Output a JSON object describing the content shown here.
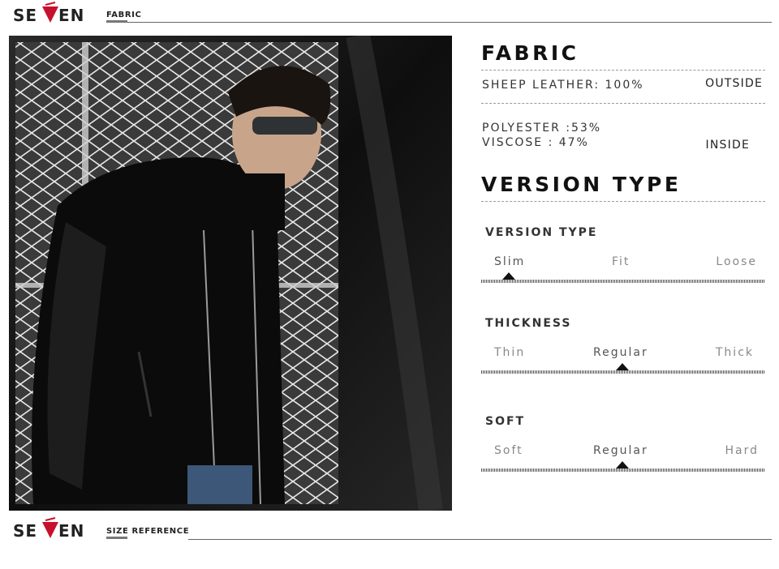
{
  "brand": {
    "name": "SEVEN"
  },
  "header": {
    "section": "FABRIC"
  },
  "footer": {
    "section": "SIZE REFERENCE"
  },
  "fabric": {
    "title": "FABRIC",
    "outside": {
      "line1": "SHEEP LEATHER: 100%",
      "side": "OUTSIDE"
    },
    "inside": {
      "line1": "POLYESTER :53%",
      "line2": "VISCOSE : 47%",
      "side": "INSIDE"
    }
  },
  "version": {
    "title": "VERSION TYPE",
    "scales": [
      {
        "name": "VERSION TYPE",
        "options": [
          "Slim",
          "Fit",
          "Loose"
        ],
        "selected": "Slim"
      },
      {
        "name": "THICKNESS",
        "options": [
          "Thin",
          "Regular",
          "Thick"
        ],
        "selected": "Regular"
      },
      {
        "name": "SOFT",
        "options": [
          "Soft",
          "Regular",
          "Hard"
        ],
        "selected": "Regular"
      }
    ]
  },
  "colors": {
    "logo_accent": "#c8102e",
    "logo_text": "#222222",
    "photo_bg": "#141414"
  },
  "icons": {
    "logo": "seven-logo",
    "marker": "triangle-marker-icon"
  }
}
